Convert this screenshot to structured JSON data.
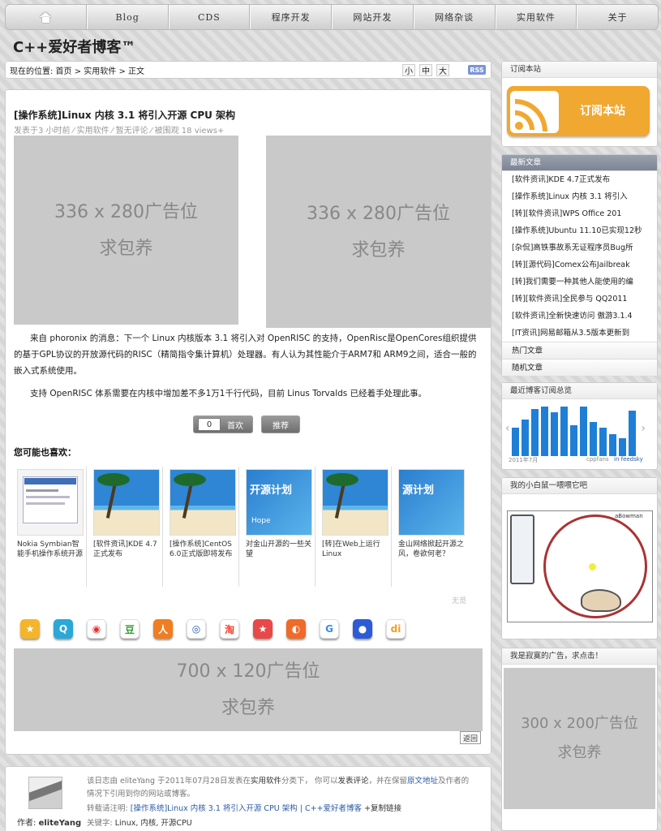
{
  "nav": {
    "home_icon": "home-icon",
    "items": [
      "Blog",
      "CDS",
      "程序开发",
      "网站开发",
      "网络杂谈",
      "实用软件",
      "关于"
    ]
  },
  "site": {
    "title": "C++爱好者博客™"
  },
  "breadcrumb": {
    "text": "现在的位置: 首页 > 实用软件 > 正文",
    "font_small": "小",
    "font_mid": "中",
    "font_large": "大",
    "rss": "RSS"
  },
  "post": {
    "title": "[操作系统]Linux 内核 3.1 将引入开源 CPU 架构",
    "meta": "发表于3 小时前 ⁄ 实用软件 ⁄ 暂无评论 ⁄ 被围观 18 views+",
    "ad1_line1": "336 x 280广告位",
    "ad1_line2": "求包养",
    "ad2_line1": "336 x 280广告位",
    "ad2_line2": "求包养",
    "para1": "来自 phoronix 的消息：下一个 Linux 内核版本 3.1 将引入对 OpenRISC 的支持，OpenRisc是OpenCores组织提供的基于GPL协议的开放源代码的RISC（精简指令集计算机）处理器。有人认为其性能介于ARM7和 ARM9之间，适合一般的嵌入式系统使用。",
    "para2": "支持 OpenRISC 体系需要在内核中增加差不多1万1千行代码，目前 Linus Torvalds 已经着手处理此事。",
    "vote_count": "0",
    "vote_label": "首欢",
    "share_label": "推荐",
    "related_heading": "您可能也喜欢：",
    "related": [
      {
        "caption": "Nokia Symbian智能手机操作系统开源"
      },
      {
        "caption": "[软件资讯]KDE 4.7正式发布"
      },
      {
        "caption": "[操作系统]CentOS 6.0正式版即将发布"
      },
      {
        "caption": "对金山开源的一些关望"
      },
      {
        "caption": "[转]在Web上运行Linux"
      },
      {
        "caption": "金山网络掀起开源之风，卷欲何老？"
      }
    ],
    "related_footer": "无觅",
    "share_icons": [
      "qzone-icon",
      "qq-icon",
      "weibo-icon",
      "douban-icon",
      "renren-icon",
      "kaixin-icon",
      "taobao-icon",
      "qq-favorite-icon",
      "xianguo-icon",
      "google-icon",
      "baidu-icon",
      "digu-icon"
    ],
    "ad3_line1": "700 x 120广告位",
    "ad3_line2": "求包养",
    "back_label": "返回"
  },
  "author": {
    "label": "作者:",
    "name": "eliteYang",
    "line1a": "该日志由 eliteYang 于2011年07月28日发表在",
    "line1_cat": "实用软件",
    "line1b": "分类下， 你可以",
    "line1_comment": "发表评论",
    "line1c": "，并在保留",
    "line1_link": "原文地址",
    "line1d": "及作者的",
    "line2": "情况下引用到你的网站或博客。",
    "reprint_label": "转载请注明:",
    "reprint_link": "[操作系统]Linux 内核 3.1 将引入开源 CPU 架构 | C++爱好者博客",
    "copy_link": "+复制链接",
    "keywords_label": "关键字:",
    "keywords": "Linux, 内核, 开源CPU"
  },
  "sidebar": {
    "subscribe_head": "订阅本站",
    "subscribe_btn": "订阅本站",
    "latest_head": "最新文章",
    "latest": [
      "[软件资讯]KDE 4.7正式发布",
      "[操作系统]Linux 内核 3.1 将引入",
      "[转][软件资讯]WPS Office 201",
      "[操作系统]Ubuntu 11.10已实现12秒",
      "[杂侃]高铁事故系无证程序员Bug所",
      "[转][源代码]Comex公布Jailbreak",
      "[转]我们需要一种其他人能使用的编",
      "[转][软件资讯]全民参与 QQ2011",
      "[软件资讯]全新快速访问 傲游3.1.4",
      "[IT资讯]网易邮箱从3.5版本更新到"
    ],
    "hot_head": "热门文章",
    "random_head": "随机文章",
    "feed_head": "最近博客订阅总览",
    "feed_chart_footer_left": "2011年7月",
    "feed_chart_footer_mid": "cppfans",
    "feed_chart_footer_right": "in feedsky",
    "hamster_head": "我的小白鼠一喂喂它吧",
    "hamster_brand": "aBowman",
    "ad_head": "我是寂寞的广告，求点击！",
    "ad_line1": "300 x 200广告位",
    "ad_line2": "求包养"
  },
  "colors": {
    "accent_orange": "#f0a830",
    "link_blue": "#2a5aa6",
    "chart_blue": "#1f7fd6"
  }
}
